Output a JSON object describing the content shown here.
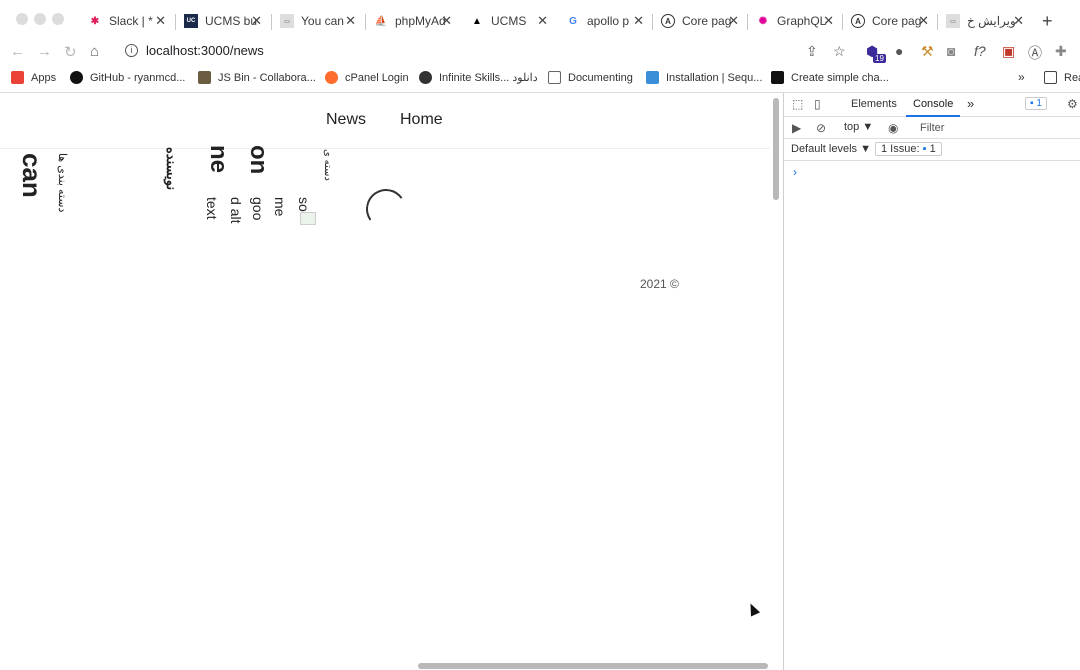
{
  "browser": {
    "tabs": [
      {
        "title": "Slack | *",
        "icon": "slack-icon",
        "color": "#e01e5a"
      },
      {
        "title": "UCMS bu",
        "icon": "ucms-icon",
        "color": "#1b2a4a"
      },
      {
        "title": "You can",
        "icon": "page-icon",
        "color": "#888888"
      },
      {
        "title": "phpMyAd",
        "icon": "phpmyadmin-icon",
        "color": "#f29111"
      },
      {
        "title": "UCMS",
        "icon": "vercel-icon",
        "color": "#000000"
      },
      {
        "title": "apollo p",
        "icon": "google-icon",
        "color": "#4285f4"
      },
      {
        "title": "Core pag",
        "icon": "apollo-icon",
        "color": "#333333"
      },
      {
        "title": "GraphQL",
        "icon": "graphql-icon",
        "color": "#e10098"
      },
      {
        "title": "Core pag",
        "icon": "apollo-icon",
        "color": "#333333"
      },
      {
        "title": "ویرایش خ",
        "icon": "ucms-icon",
        "color": "#888888"
      }
    ],
    "url": "localhost:3000/news",
    "extension_badge": "19",
    "bookmarks": [
      {
        "label": "Apps",
        "icon": "apps-icon",
        "color": "#ea4335"
      },
      {
        "label": "GitHub - ryanmcd...",
        "icon": "github-icon",
        "color": "#111111"
      },
      {
        "label": "JS Bin - Collabora...",
        "icon": "jsbin-icon",
        "color": "#6b5d3f"
      },
      {
        "label": "cPanel Login",
        "icon": "cpanel-icon",
        "color": "#ff6c2c"
      },
      {
        "label": "Infinite Skills... دانلود",
        "icon": "globe-icon",
        "color": "#333333"
      },
      {
        "label": "Documenting",
        "icon": "folder-icon",
        "color": "#666666"
      },
      {
        "label": "Installation | Sequ...",
        "icon": "sequelize-icon",
        "color": "#3b8fd9"
      },
      {
        "label": "Create simple cha...",
        "icon": "video-icon",
        "color": "#111111"
      },
      {
        "label": "Rea",
        "icon": "reading-list-icon",
        "color": "#444444"
      }
    ]
  },
  "page": {
    "nav": {
      "news": "News",
      "home": "Home"
    },
    "vertical_texts": {
      "can": "can",
      "arabic_1": "دسته بندی ها",
      "arabic_2": "نویسنده",
      "ne": "ne",
      "on": "on",
      "text": "text",
      "d_alt": "d alt",
      "goo": "goo",
      "me": "me",
      "so": "so",
      "arabic_3": "دسته ی"
    },
    "footer": "2021 ©"
  },
  "devtools": {
    "tabs": {
      "elements": "Elements",
      "console": "Console",
      "more": "»"
    },
    "message_count": "1",
    "context": "top ▼",
    "filter_placeholder": "Filter",
    "levels": "Default levels ▼",
    "issues": "1 Issue:",
    "issues_count": "1",
    "prompt": "›"
  },
  "colors": {
    "accent": "#1a73e8"
  }
}
